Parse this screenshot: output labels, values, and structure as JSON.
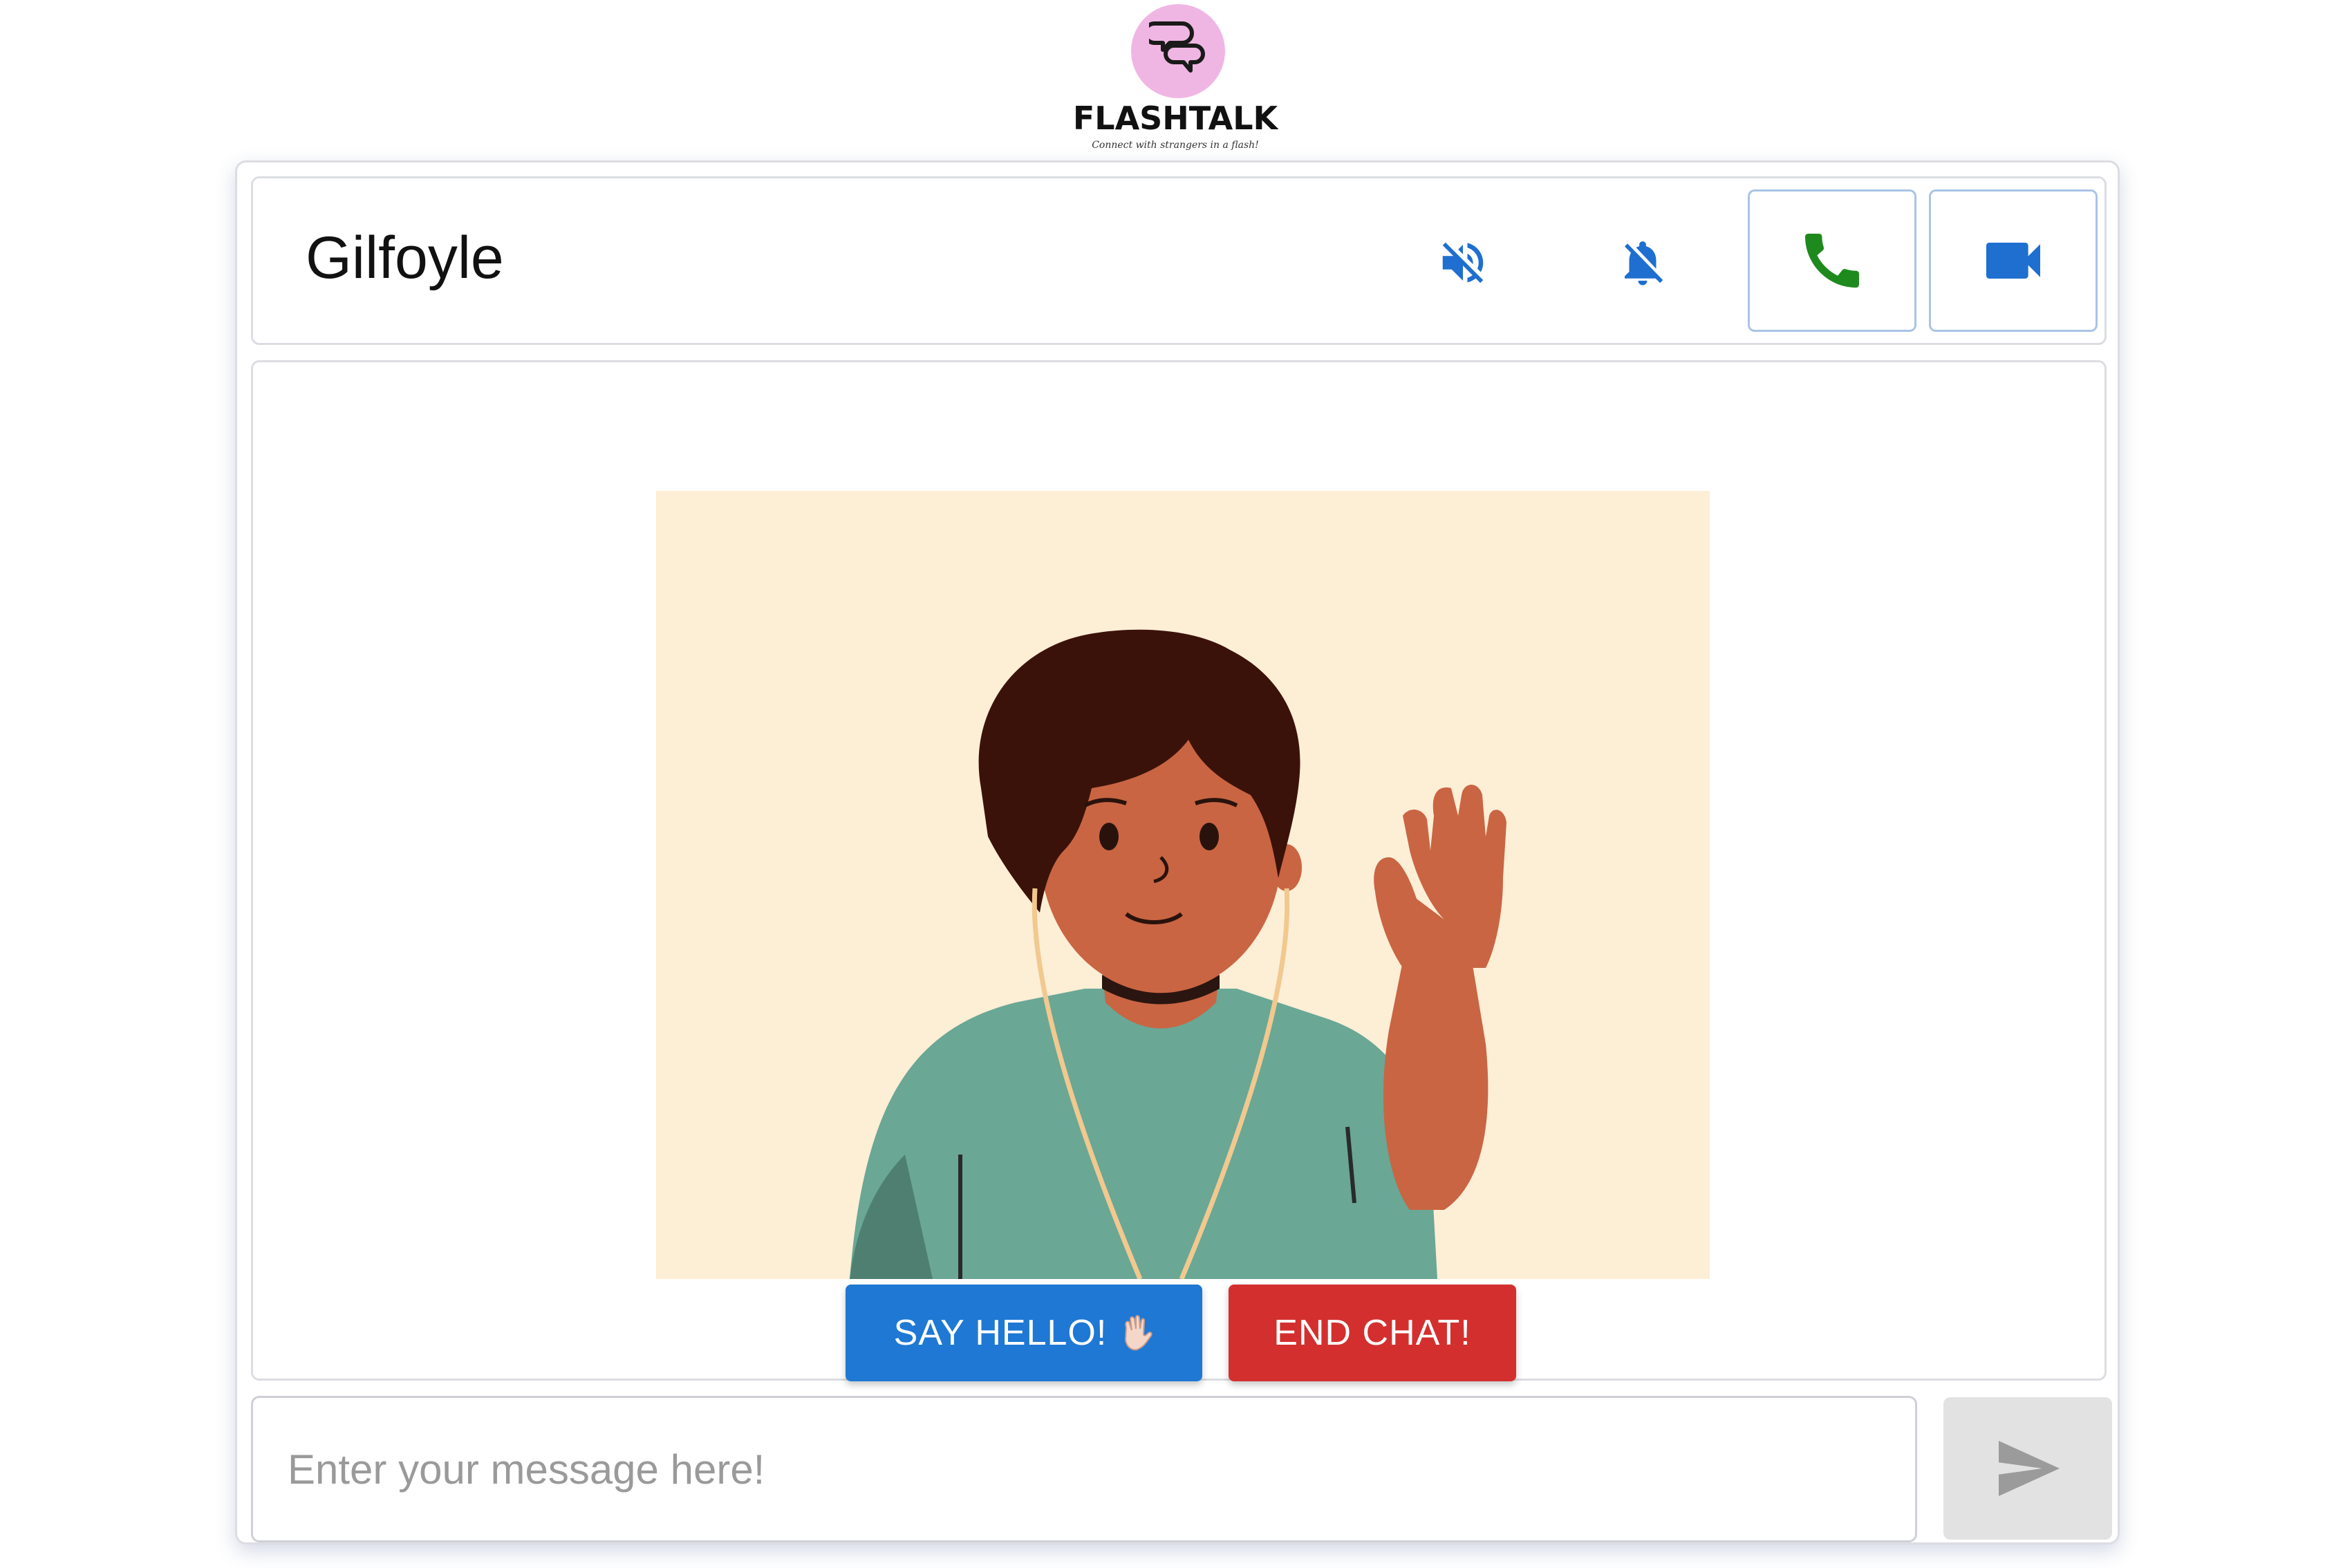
{
  "logo": {
    "name": "FLASHTALK",
    "tagline": "Connect with strangers in a flash!",
    "circle_color": "#f0b6e3"
  },
  "header": {
    "username": "Gilfoyle",
    "icons": {
      "mute": "volume-off-icon",
      "notifications": "notifications-off-icon",
      "call": "phone-icon",
      "video": "videocam-icon"
    },
    "colors": {
      "accent": "#1e6fd0",
      "call": "#1e8a1e"
    }
  },
  "main": {
    "illustration": "waving-person-with-earphones",
    "say_hello_label": "SAY HELLO!",
    "say_hello_emoji": "waving-hand-icon",
    "end_chat_label": "END CHAT!",
    "colors": {
      "say_hello": "#1e78d4",
      "end_chat": "#d42f2f"
    }
  },
  "composer": {
    "placeholder": "Enter your message here!",
    "value": "",
    "send_icon": "send-icon"
  }
}
